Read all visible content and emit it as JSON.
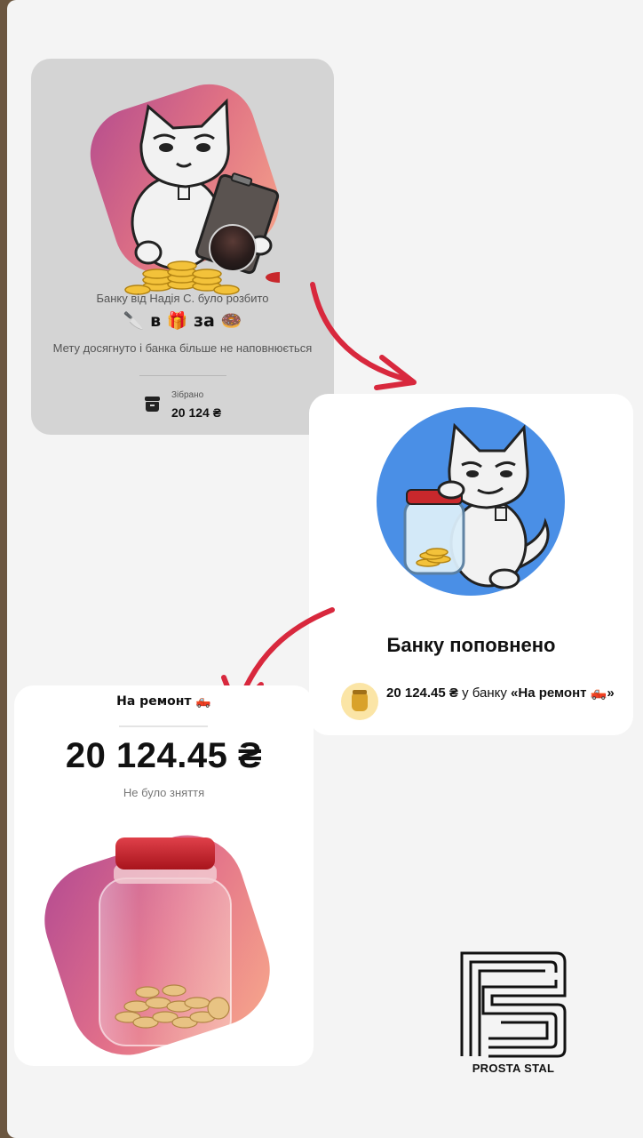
{
  "broken_card": {
    "broken_text": "Банку від Надія С. було розбито",
    "emoji_row": "🔪 в 🎁 за 🍩",
    "goal_text": "Мету досягнуто і банка більше не наповнюється",
    "collected_label": "Зібрано",
    "collected_amount": "20 124 ₴"
  },
  "topup_card": {
    "title": "Банку поповнено",
    "amount": "20 124.45 ₴",
    "text_in": " у банку ",
    "jar_name": "«На ремонт 🛻»"
  },
  "jar_card": {
    "name": "На ремонт 🛻",
    "amount": "20 124.45 ₴",
    "subtitle": "Не було зняття"
  },
  "logo": {
    "text": "PROSTA STAL"
  },
  "colors": {
    "arrow": "#d8283d",
    "blob_start": "#b64d8e",
    "blob_end": "#f6a48a",
    "circle_blue": "#4a8fe6"
  },
  "icons": [
    "box-icon",
    "jar-icon",
    "cat-illustration",
    "jar-illustration",
    "arrow"
  ]
}
